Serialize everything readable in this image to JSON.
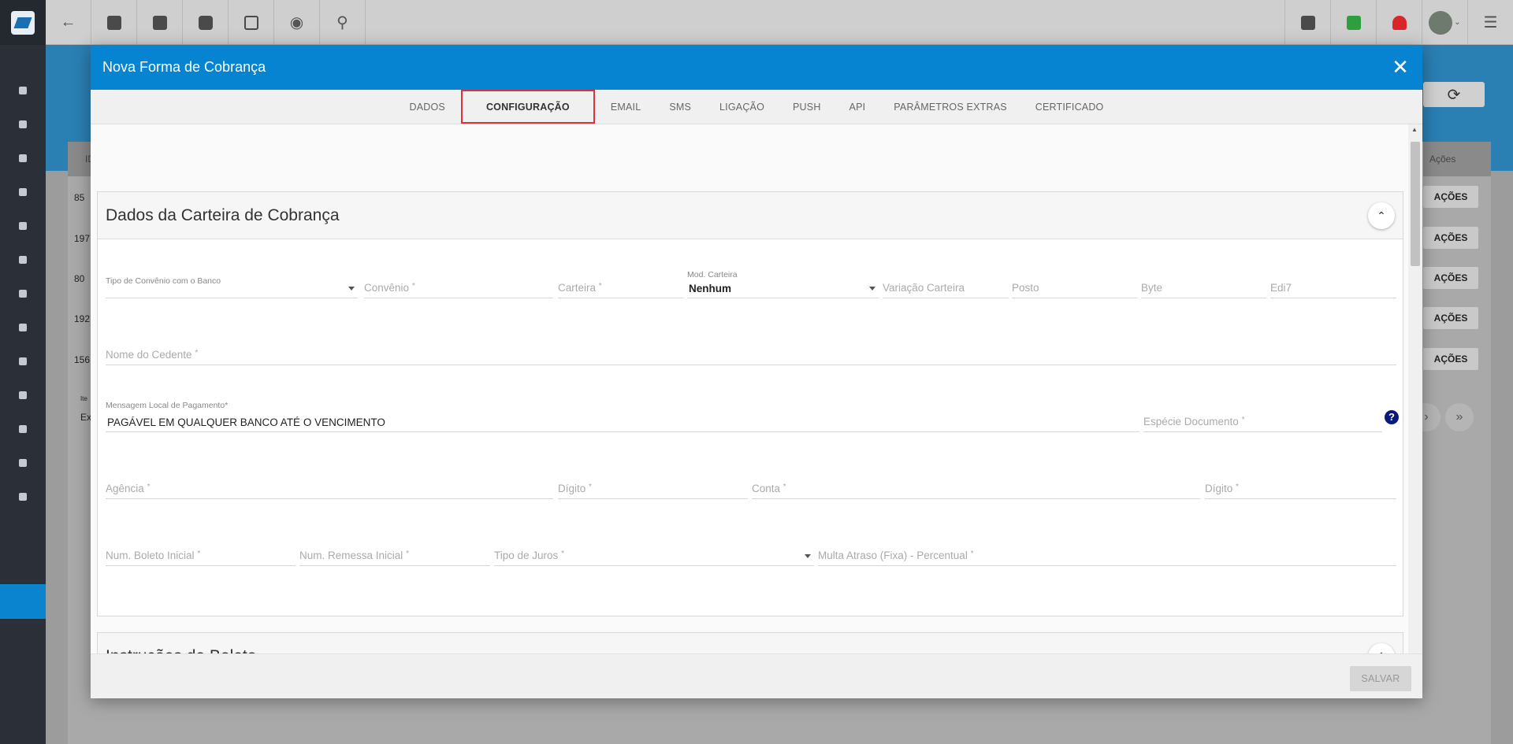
{
  "topbar": {
    "left_icons": [
      "back-arrow-icon",
      "contact-card-icon",
      "calendar-clock-icon",
      "dollar-icon",
      "terminal-icon",
      "eye-icon",
      "search-icon"
    ],
    "right_icons": [
      "pdf-icon",
      "checked-chat-icon",
      "alarm-bell-icon",
      "user-avatar",
      "list-menu-icon"
    ]
  },
  "background": {
    "ids": [
      "85",
      "197",
      "80",
      "192",
      "156"
    ],
    "acoes_header": "Ações",
    "acoes_button": "AÇÕES",
    "id_header": "ID",
    "items_label": "Ite",
    "items_value": "Ex"
  },
  "modal": {
    "title": "Nova Forma de Cobrança",
    "tabs": [
      "DADOS",
      "CONFIGURAÇÃO",
      "EMAIL",
      "SMS",
      "LIGAÇÃO",
      "PUSH",
      "API",
      "PARÂMETROS EXTRAS",
      "CERTIFICADO"
    ],
    "active_tab": "CONFIGURAÇÃO",
    "panel1": {
      "title": "Dados da Carteira de Cobrança",
      "tipo_convenio": {
        "label": "Tipo de Convênio com o Banco"
      },
      "convenio": {
        "label": "Convênio"
      },
      "carteira": {
        "label": "Carteira"
      },
      "mod_carteira": {
        "label": "Mod. Carteira",
        "value": "Nenhum"
      },
      "variacao_carteira": {
        "label": "Variação Carteira"
      },
      "posto": {
        "label": "Posto"
      },
      "byte": {
        "label": "Byte"
      },
      "edi7": {
        "label": "Edi7"
      },
      "nome_cedente": {
        "label": "Nome do Cedente"
      },
      "mensagem_local": {
        "label": "Mensagem Local de Pagamento",
        "value": "PAGÁVEL EM QUALQUER BANCO ATÉ O VENCIMENTO"
      },
      "especie_documento": {
        "label": "Espécie Documento"
      },
      "agencia": {
        "label": "Agência"
      },
      "digito1": {
        "label": "Dígito"
      },
      "conta": {
        "label": "Conta"
      },
      "digito2": {
        "label": "Dígito"
      },
      "num_boleto_inicial": {
        "label": "Num. Boleto Inicial"
      },
      "num_remessa_inicial": {
        "label": "Num. Remessa Inicial"
      },
      "tipo_juros": {
        "label": "Tipo de Juros"
      },
      "multa_atraso": {
        "label": "Multa Atraso (Fixa) - Percentual"
      },
      "required_mark": "*",
      "help": "?"
    },
    "panel2": {
      "title": "Instruções do Boleto"
    },
    "save_label": "SALVAR",
    "close_glyph": "✕",
    "toggle_glyph": "⌃"
  }
}
